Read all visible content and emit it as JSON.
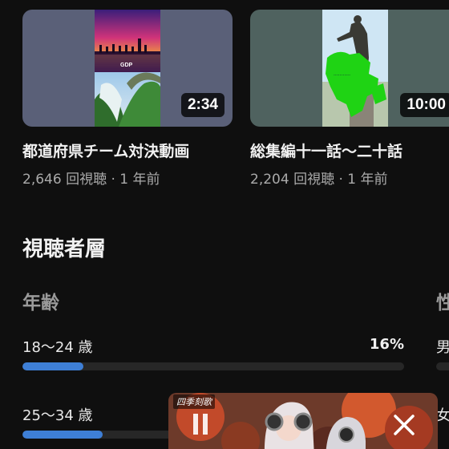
{
  "videos": [
    {
      "title": "都道府県チーム対決動画",
      "duration": "2:34",
      "views": "2,646 回視聴",
      "age": "1 年前",
      "thumb_caption": "GDP"
    },
    {
      "title": "総集編十一話〜二十話",
      "duration": "10:00",
      "views": "2,204 回視聴",
      "age": "1 年前"
    }
  ],
  "separator": "·",
  "audience": {
    "title": "視聴者層",
    "age_heading": "年齢",
    "gender_heading": "性",
    "rows": [
      {
        "label": "18〜24 歳",
        "percent_text": "16%",
        "fraction": 0.16
      },
      {
        "label": "25〜34 歳",
        "fraction": 0.21
      }
    ],
    "gender_labels": [
      "男",
      "女"
    ]
  },
  "mini_player": {
    "label": "四季刻歌",
    "pause_icon": "pause-icon",
    "close_icon": "close-icon"
  },
  "colors": {
    "background": "#0f0f0f",
    "bar_fill": "#3e7fd6",
    "bar_track": "#272727"
  }
}
